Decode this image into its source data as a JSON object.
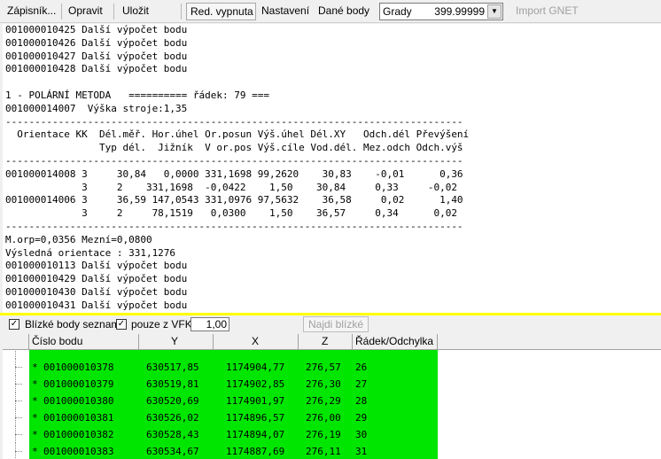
{
  "toolbar": {
    "zapisnik": "Zápisník...",
    "opravit": "Opravit",
    "ulozit": "Uložit",
    "red_vypnuta": "Red. vypnuta",
    "nastaveni": "Nastavení",
    "dane_body": "Dané body",
    "grady_label": "Grady",
    "grady_value": "399.99999",
    "import_gnet": "Import GNET"
  },
  "output_text": "001000010425 Další výpočet bodu\n001000010426 Další výpočet bodu\n001000010427 Další výpočet bodu\n001000010428 Další výpočet bodu\n\n1 - POLÁRNÍ METODA   ========== řádek: 79 ===\n001000014007  Výška stroje:1,35\n------------------------------------------------------------------------------\n  Orientace KK  Dél.měř. Hor.úhel Or.posun Výš.úhel Dél.XY   Odch.dél Převýšení\n                Typ dél.  Jižník  V or.pos Výš.cíle Vod.dél. Mez.odch Odch.výš\n------------------------------------------------------------------------------\n001000014008 3     30,84   0,0000 331,1698 99,2620    30,83    -0,01      0,36\n             3     2    331,1698  -0,0422    1,50    30,84     0,33     -0,02\n001000014006 3     36,59 147,0543 331,0976 97,5632    36,58     0,02      1,40\n             3     2     78,1519   0,0300    1,50    36,57     0,34      0,02\n------------------------------------------------------------------------------\nM.orp=0,0356 Mezní=0,0800\nVýsledná orientace : 331,1276\n001000010113 Další výpočet bodu\n001000010429 Další výpočet bodu\n001000010430 Další výpočet bodu\n001000010431 Další výpočet bodu",
  "options": {
    "blizke_seznam_label": "Blízké body seznam",
    "blizke_seznam_checked": true,
    "pouze_vfk_label": "pouze z VFK",
    "pouze_vfk_checked": true,
    "limit_value": "1,00",
    "find_button": "Najdi blízké"
  },
  "grid": {
    "columns": [
      "Číslo bodu",
      "Y",
      "X",
      "Z",
      "Řádek/Odchylka"
    ],
    "rows": [
      {
        "marker": "*",
        "cislo": "001000010378",
        "y": "630517,85",
        "x": "1174904,77",
        "z": "276,57",
        "radek": "26"
      },
      {
        "marker": "*",
        "cislo": "001000010379",
        "y": "630519,81",
        "x": "1174902,85",
        "z": "276,30",
        "radek": "27"
      },
      {
        "marker": "*",
        "cislo": "001000010380",
        "y": "630520,69",
        "x": "1174901,97",
        "z": "276,29",
        "radek": "28"
      },
      {
        "marker": "*",
        "cislo": "001000010381",
        "y": "630526,02",
        "x": "1174896,57",
        "z": "276,00",
        "radek": "29"
      },
      {
        "marker": "*",
        "cislo": "001000010382",
        "y": "630528,43",
        "x": "1174894,07",
        "z": "276,19",
        "radek": "30"
      },
      {
        "marker": "*",
        "cislo": "001000010383",
        "y": "630534,67",
        "x": "1174887,69",
        "z": "276,11",
        "radek": "31"
      }
    ]
  },
  "colors": {
    "row_highlight": "#00e600",
    "splitter": "#ffff00"
  }
}
